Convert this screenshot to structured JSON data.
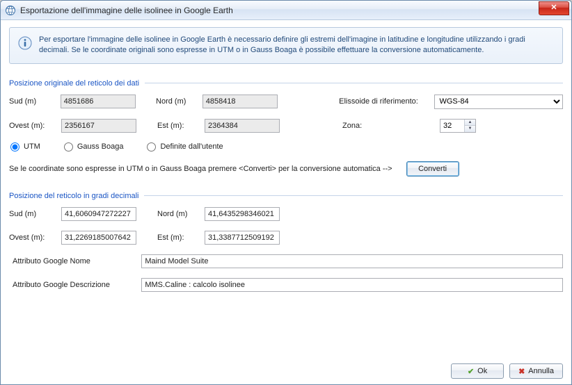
{
  "window": {
    "title": "Esportazione dell'immagine delle isolinee in Google Earth"
  },
  "banner": {
    "text": "Per esportare l'immagine delle isolinee in Google Earth è necessario definire gli estremi dell'imagine in latitudine e longitudine utilizzando i gradi decimali. Se le coordinate originali sono espresse in UTM o in Gauss Boaga è possibile effettuare la conversione automaticamente."
  },
  "sections": {
    "reticolo_orig": "Posizione originale del reticolo dei dati",
    "reticolo_dec": "Posizione del reticolo in gradi decimali"
  },
  "labels": {
    "sud": "Sud (m)",
    "nord": "Nord (m)",
    "ovest": "Ovest (m):",
    "est": "Est (m):",
    "ellissoide": "Elissoide di riferimento:",
    "zona": "Zona:",
    "attr_nome": "Attributo Google Nome",
    "attr_descr": "Attributo Google Descrizione"
  },
  "orig": {
    "sud": "4851686",
    "nord": "4858418",
    "ovest": "2356167",
    "est": "2364384",
    "ellissoide_selected": "WGS-84",
    "zona": "32"
  },
  "radios": {
    "utm": "UTM",
    "gauss": "Gauss Boaga",
    "user": "Definite dall'utente",
    "selected": "utm"
  },
  "hint": {
    "text": "Se le coordinate sono espresse in UTM o in Gauss Boaga premere <Converti> per la conversione automatica -->",
    "button": "Converti"
  },
  "dec": {
    "sud": "41,6060947272227",
    "nord": "41,6435298346021",
    "ovest": "31,2269185007642",
    "est": "31,3387712509192"
  },
  "attrs": {
    "nome": "Maind Model Suite",
    "descr": "MMS.Caline : calcolo isolinee"
  },
  "buttons": {
    "ok": "Ok",
    "cancel": "Annulla"
  }
}
